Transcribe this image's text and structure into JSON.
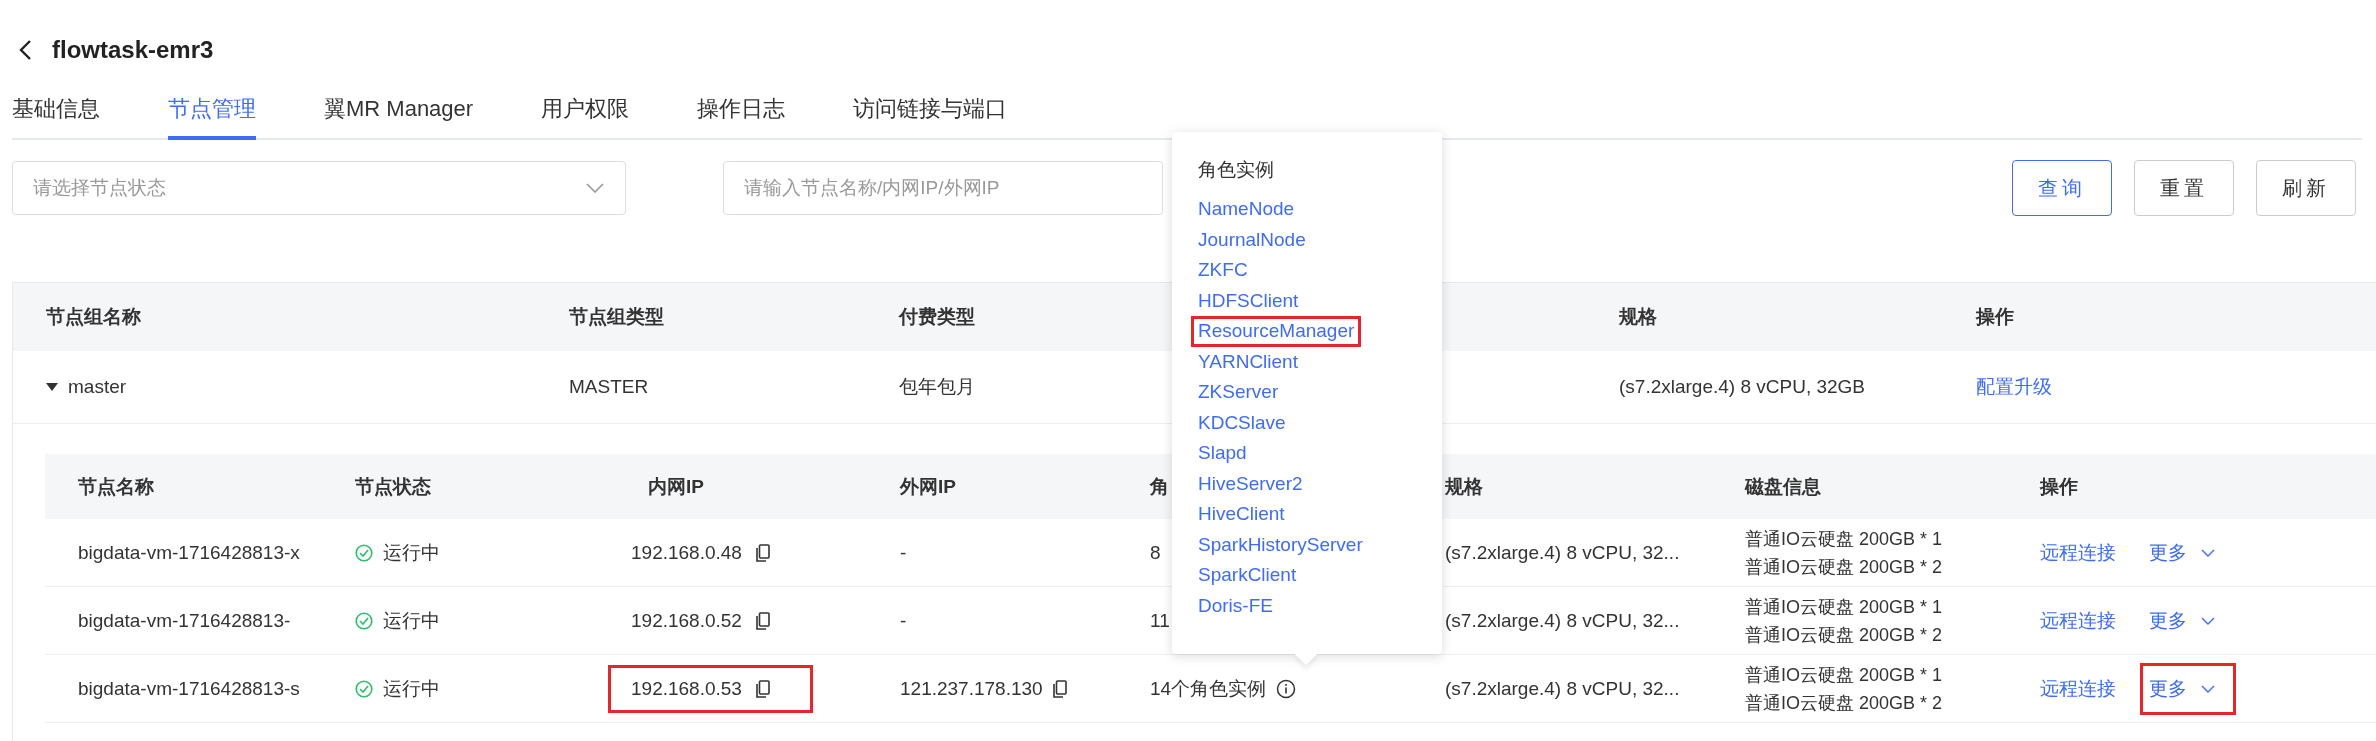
{
  "header": {
    "title": "flowtask-emr3"
  },
  "tabs": [
    {
      "label": "基础信息",
      "selected": false
    },
    {
      "label": "节点管理",
      "selected": true
    },
    {
      "label": "翼MR Manager",
      "selected": false
    },
    {
      "label": "用户权限",
      "selected": false
    },
    {
      "label": "操作日志",
      "selected": false
    },
    {
      "label": "访问链接与端口",
      "selected": false
    }
  ],
  "filters": {
    "status_select": {
      "placeholder": "请选择节点状态"
    },
    "search": {
      "placeholder": "请输入节点名称/内网IP/外网IP"
    },
    "buttons": [
      {
        "label": "查询",
        "primary": true
      },
      {
        "label": "重置",
        "primary": false
      },
      {
        "label": "刷新",
        "primary": false
      }
    ]
  },
  "group_table": {
    "columns": [
      "节点组名称",
      "节点组类型",
      "付费类型",
      "规格",
      "操作"
    ],
    "rows": [
      {
        "name": "master",
        "expanded": true,
        "type": "MASTER",
        "billing": "包年包月",
        "spec": "(s7.2xlarge.4) 8 vCPU, 32GB",
        "action": "配置升级"
      }
    ]
  },
  "node_table": {
    "columns": [
      "节点名称",
      "节点状态",
      "内网IP",
      "外网IP",
      "角",
      "规格",
      "磁盘信息",
      "操作"
    ],
    "rows": [
      {
        "name": "bigdata-vm-1716428813-x",
        "status": "运行中",
        "ip": "192.168.0.48",
        "ip_highlighted": false,
        "public_ip": "-",
        "roles": "8",
        "role_info": false,
        "spec": "(s7.2xlarge.4) 8 vCPU, 32...",
        "disks": [
          "普通IO云硬盘 200GB * 1",
          "普通IO云硬盘 200GB * 2"
        ],
        "connect": "远程连接",
        "more": "更多",
        "more_highlighted": false
      },
      {
        "name": "bigdata-vm-1716428813-",
        "status": "运行中",
        "ip": "192.168.0.52",
        "ip_highlighted": false,
        "public_ip": "-",
        "roles": "11",
        "role_info": false,
        "spec": "(s7.2xlarge.4) 8 vCPU, 32...",
        "disks": [
          "普通IO云硬盘 200GB * 1",
          "普通IO云硬盘 200GB * 2"
        ],
        "connect": "远程连接",
        "more": "更多",
        "more_highlighted": false
      },
      {
        "name": "bigdata-vm-1716428813-s",
        "status": "运行中",
        "ip": "192.168.0.53",
        "ip_highlighted": true,
        "public_ip": "121.237.178.130",
        "roles": "14个角色实例",
        "role_info": true,
        "spec": "(s7.2xlarge.4) 8 vCPU, 32...",
        "disks": [
          "普通IO云硬盘 200GB * 1",
          "普通IO云硬盘 200GB * 2"
        ],
        "connect": "远程连接",
        "more": "更多",
        "more_highlighted": true
      }
    ]
  },
  "popover": {
    "title": "角色实例",
    "items": [
      {
        "label": "NameNode",
        "highlighted": false
      },
      {
        "label": "JournalNode",
        "highlighted": false
      },
      {
        "label": "ZKFC",
        "highlighted": false
      },
      {
        "label": "HDFSClient",
        "highlighted": false
      },
      {
        "label": "ResourceManager",
        "highlighted": true
      },
      {
        "label": "YARNClient",
        "highlighted": false
      },
      {
        "label": "ZKServer",
        "highlighted": false
      },
      {
        "label": "KDCSlave",
        "highlighted": false
      },
      {
        "label": "Slapd",
        "highlighted": false
      },
      {
        "label": "HiveServer2",
        "highlighted": false
      },
      {
        "label": "HiveClient",
        "highlighted": false
      },
      {
        "label": "SparkHistoryServer",
        "highlighted": false
      },
      {
        "label": "SparkClient",
        "highlighted": false
      },
      {
        "label": "Doris-FE",
        "highlighted": false
      }
    ]
  }
}
